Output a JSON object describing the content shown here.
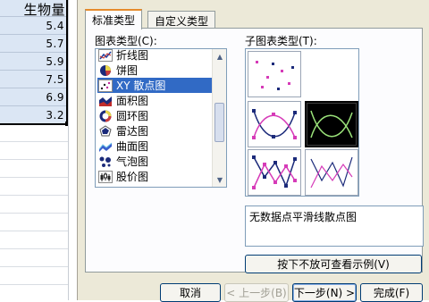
{
  "sheet": {
    "header": "生物量",
    "values": [
      "5.4",
      "5.7",
      "5.9",
      "7.5",
      "6.9",
      "3.2"
    ]
  },
  "dialog": {
    "tabs": [
      {
        "label": "标准类型",
        "active": true
      },
      {
        "label": "自定义类型",
        "active": false
      }
    ],
    "chart_type_label": "图表类型(C):",
    "subtype_label": "子图表类型(T):",
    "chart_types": [
      {
        "label": "折线图",
        "icon": "line-chart-icon"
      },
      {
        "label": "饼图",
        "icon": "pie-chart-icon"
      },
      {
        "label": "XY 散点图",
        "icon": "scatter-chart-icon",
        "selected": true
      },
      {
        "label": "面积图",
        "icon": "area-chart-icon"
      },
      {
        "label": "圆环图",
        "icon": "doughnut-chart-icon"
      },
      {
        "label": "雷达图",
        "icon": "radar-chart-icon"
      },
      {
        "label": "曲面图",
        "icon": "surface-chart-icon"
      },
      {
        "label": "气泡图",
        "icon": "bubble-chart-icon"
      },
      {
        "label": "股价图",
        "icon": "stock-chart-icon"
      }
    ],
    "subtypes": [
      {
        "icon": "scatter-markers-only-icon"
      },
      {
        "icon": "scatter-smooth-with-markers-icon"
      },
      {
        "icon": "scatter-smooth-no-markers-icon",
        "selected": true
      },
      {
        "icon": "scatter-straight-with-markers-icon"
      },
      {
        "icon": "scatter-straight-no-markers-icon"
      }
    ],
    "description": "无数据点平滑线散点图",
    "preview_button": "按下不放可查看示例(V)",
    "buttons": {
      "cancel": "取消",
      "back": "< 上一步(B)",
      "next": "下一步(N) >",
      "finish": "完成(F)"
    }
  },
  "colors": {
    "selection": "#316ac5",
    "dialog_bg": "#ece9d8",
    "tab_accent": "#e68b2c",
    "marker_magenta": "#d63bb8"
  }
}
